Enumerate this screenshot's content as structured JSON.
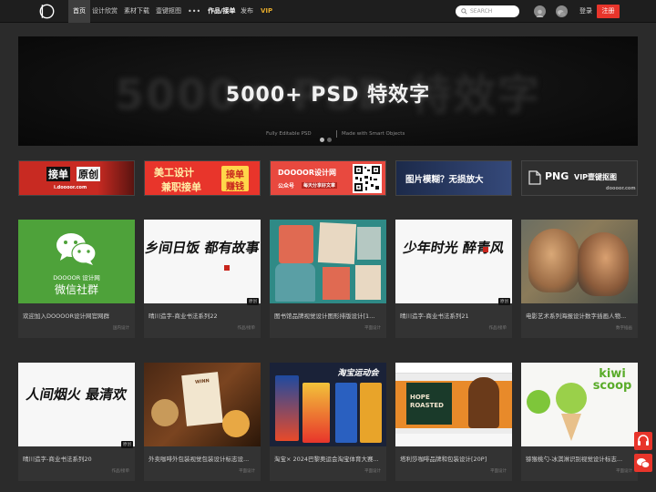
{
  "nav": {
    "items": [
      {
        "label": "首页",
        "active": true
      },
      {
        "label": "设计欣赏"
      },
      {
        "label": "素材下载"
      },
      {
        "label": "壹键抠图"
      },
      {
        "label": "•••"
      },
      {
        "label": "作品/接单",
        "bold": true
      },
      {
        "label": "发布"
      },
      {
        "label": "VIP",
        "vip": true
      }
    ],
    "search_placeholder": "SEARCH",
    "login_label": "登录",
    "register_label": "注册",
    "icons": [
      "logo-icon",
      "search-icon",
      "notification-icon",
      "wechat-icon"
    ]
  },
  "hero": {
    "bg_text": "5000+ PSD 特效字",
    "title": "5000+ PSD 特效字",
    "sub_left": "Fully Editable PSD",
    "sub_right": "Made with Smart Objects"
  },
  "ads": [
    {
      "line1": "接单",
      "line2": "原创",
      "sub": "i.doooor.com",
      "color": "#d8322a"
    },
    {
      "line1": "美工设计",
      "line2": "兼职接单",
      "tag1": "接单",
      "tag2": "赚钱",
      "color": "#e8352b"
    },
    {
      "line1": "DOOOOR设计网",
      "line2": "公众号",
      "line3": "每天分享好文章",
      "color": "#e84a44"
    },
    {
      "line1": "图片模糊？无损放大",
      "color": "#26355a"
    },
    {
      "line1": "PNG",
      "line2": "VIP壹键抠图",
      "sub": "doooor.com",
      "color": "#3a3a3a"
    }
  ],
  "cards_row1": [
    {
      "title": "欢迎加入DOOOOR设计网官网群",
      "category": "国内设计",
      "thumb_brand": "DOOOOR 设计网",
      "thumb_text": "微信社群",
      "badge": ""
    },
    {
      "title": "晴川造字-商业书法系列22",
      "category": "作品/接单",
      "thumb_text": "乡间日饭 都有故事",
      "badge": "原创"
    },
    {
      "title": "图书馆品牌视觉设计图形排版设计[1...",
      "category": "平面设计",
      "badge": ""
    },
    {
      "title": "晴川造字-商业书法系列21",
      "category": "作品/接单",
      "thumb_text": "少年时光 醉青风",
      "badge": "原创"
    },
    {
      "title": "电影艺术系列海报设计数字插画人物...",
      "category": "数字插画",
      "badge": ""
    }
  ],
  "cards_row2": [
    {
      "title": "晴川造字-商业书法系列20",
      "category": "作品/接单",
      "thumb_text": "人间烟火 最清欢",
      "badge": "原创"
    },
    {
      "title": "外卖咖啡外包装视觉包装设计标志设...",
      "category": "平面设计",
      "thumb_text": "WINN",
      "badge": ""
    },
    {
      "title": "淘宝× 2024巴黎奥运会淘宝体育大赛...",
      "category": "平面设计",
      "thumb_text": "淘宝运动会",
      "badge": ""
    },
    {
      "title": "塔利莎咖啡品牌和包装设计[20P]",
      "category": "平面设计",
      "thumb_text": "HOPE ROASTED",
      "badge": ""
    },
    {
      "title": "猕猴桃勺-冰淇淋识别视觉设计标志...",
      "category": "平面设计",
      "thumb_text": "kiwi scoop",
      "badge": ""
    }
  ]
}
